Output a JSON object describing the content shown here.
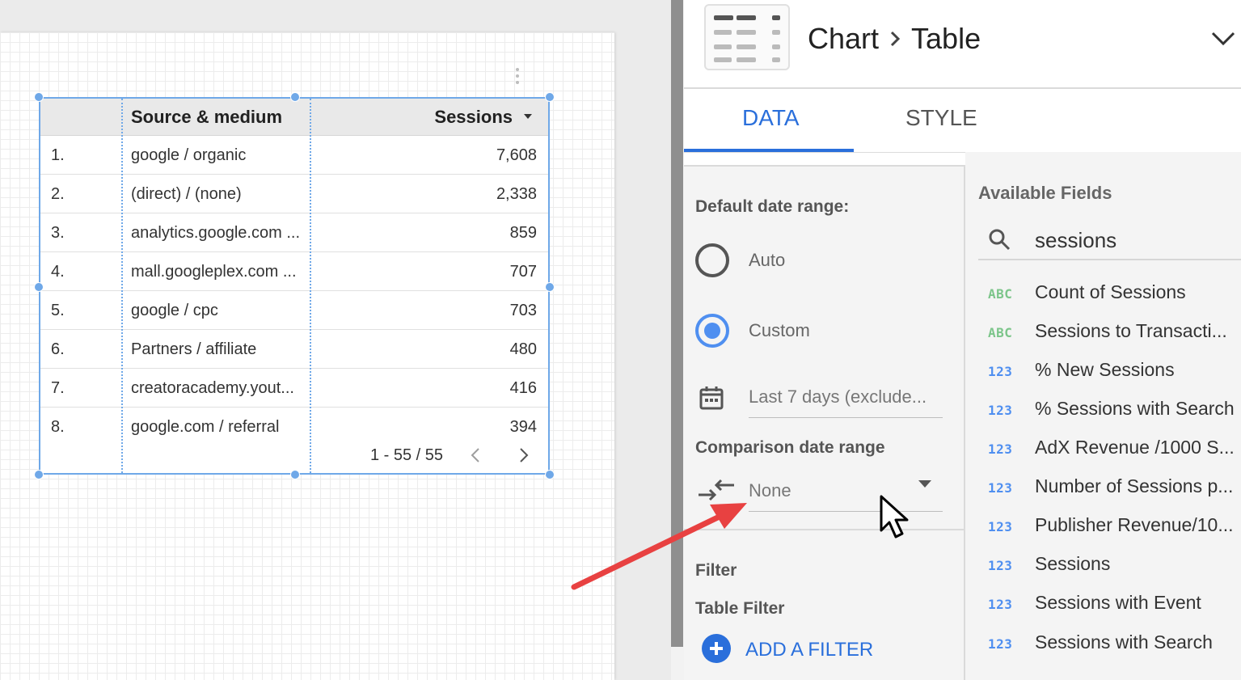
{
  "table": {
    "header_source": "Source & medium",
    "header_sessions": "Sessions",
    "rows": [
      {
        "idx": "1.",
        "source": "google / organic",
        "sessions": "7,608"
      },
      {
        "idx": "2.",
        "source": "(direct) / (none)",
        "sessions": "2,338"
      },
      {
        "idx": "3.",
        "source": "analytics.google.com ...",
        "sessions": "859"
      },
      {
        "idx": "4.",
        "source": "mall.googleplex.com ...",
        "sessions": "707"
      },
      {
        "idx": "5.",
        "source": "google / cpc",
        "sessions": "703"
      },
      {
        "idx": "6.",
        "source": "Partners / affiliate",
        "sessions": "480"
      },
      {
        "idx": "7.",
        "source": "creatoracademy.yout...",
        "sessions": "416"
      },
      {
        "idx": "8.",
        "source": "google.com / referral",
        "sessions": "394"
      }
    ],
    "pager": "1 - 55 / 55"
  },
  "panel": {
    "breadcrumb": {
      "parent": "Chart",
      "current": "Table"
    },
    "tabs": {
      "data": "DATA",
      "style": "STYLE"
    },
    "default_date_range": {
      "label": "Default date range:",
      "auto": "Auto",
      "custom": "Custom",
      "selected": "Custom",
      "range_value": "Last 7 days (exclude..."
    },
    "comparison": {
      "label": "Comparison date range",
      "value": "None"
    },
    "filter": {
      "label": "Filter",
      "sublabel": "Table Filter",
      "add_label": "ADD A FILTER"
    },
    "available_fields": {
      "title": "Available Fields",
      "search_value": "sessions",
      "items": [
        {
          "type": "ABC",
          "name": "Count of Sessions"
        },
        {
          "type": "ABC",
          "name": "Sessions to Transacti..."
        },
        {
          "type": "123",
          "name": "% New Sessions"
        },
        {
          "type": "123",
          "name": "% Sessions with Search"
        },
        {
          "type": "123",
          "name": "AdX Revenue /1000 S..."
        },
        {
          "type": "123",
          "name": "Number of Sessions p..."
        },
        {
          "type": "123",
          "name": "Publisher Revenue/10..."
        },
        {
          "type": "123",
          "name": "Sessions"
        },
        {
          "type": "123",
          "name": "Sessions with Event"
        },
        {
          "type": "123",
          "name": "Sessions with Search"
        }
      ]
    }
  },
  "colors": {
    "accent": "#2a6fdb",
    "selection": "#6fa8e8",
    "text_type_color": "#7cc58a",
    "number_type_color": "#4f8ff0",
    "annotation_arrow": "#e84141"
  }
}
